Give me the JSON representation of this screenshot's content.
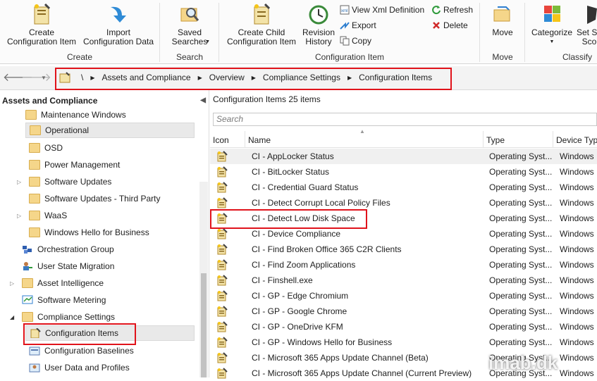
{
  "ribbon": {
    "create_ci": "Create\nConfiguration Item",
    "import_cd": "Import\nConfiguration Data",
    "group_create": "Create",
    "saved_searches": "Saved\nSearches",
    "group_search": "Search",
    "create_child": "Create Child\nConfiguration Item",
    "revision_history": "Revision\nHistory",
    "view_xml": "View Xml Definition",
    "export": "Export",
    "copy": "Copy",
    "refresh": "Refresh",
    "delete": "Delete",
    "group_ci": "Configuration Item",
    "move": "Move",
    "group_move": "Move",
    "categorize": "Categorize",
    "set_security": "Set Se\nSco",
    "group_classify": "Classify"
  },
  "address": {
    "root": "\\",
    "crumbs": [
      "Assets and Compliance",
      "Overview",
      "Compliance Settings",
      "Configuration Items"
    ]
  },
  "left": {
    "title": "Assets and Compliance",
    "items": [
      {
        "label": "Maintenance Windows"
      },
      {
        "label": "Operational"
      },
      {
        "label": "OSD"
      },
      {
        "label": "Power Management"
      },
      {
        "label": "Software Updates"
      },
      {
        "label": "Software Updates - Third Party"
      },
      {
        "label": "WaaS"
      },
      {
        "label": "Windows Hello for Business"
      },
      {
        "label": "Orchestration Group"
      },
      {
        "label": "User State Migration"
      },
      {
        "label": "Asset Intelligence"
      },
      {
        "label": "Software Metering"
      },
      {
        "label": "Compliance Settings"
      },
      {
        "label": "Configuration Items"
      },
      {
        "label": "Configuration Baselines"
      },
      {
        "label": "User Data and Profiles"
      }
    ]
  },
  "right": {
    "header": "Configuration Items 25 items",
    "search_placeholder": "Search",
    "columns": [
      "Icon",
      "Name",
      "Type",
      "Device Typ"
    ],
    "rows": [
      {
        "name": "CI - AppLocker Status",
        "type": "Operating Syst...",
        "device": "Windows"
      },
      {
        "name": "CI - BitLocker Status",
        "type": "Operating Syst...",
        "device": "Windows"
      },
      {
        "name": "CI - Credential Guard Status",
        "type": "Operating Syst...",
        "device": "Windows"
      },
      {
        "name": "CI - Detect Corrupt Local Policy Files",
        "type": "Operating Syst...",
        "device": "Windows"
      },
      {
        "name": "CI - Detect Low Disk Space",
        "type": "Operating Syst...",
        "device": "Windows"
      },
      {
        "name": "CI - Device Compliance",
        "type": "Operating Syst...",
        "device": "Windows"
      },
      {
        "name": "CI - Find Broken Office 365 C2R Clients",
        "type": "Operating Syst...",
        "device": "Windows"
      },
      {
        "name": "CI - Find Zoom Applications",
        "type": "Operating Syst...",
        "device": "Windows"
      },
      {
        "name": "CI - Finshell.exe",
        "type": "Operating Syst...",
        "device": "Windows"
      },
      {
        "name": "CI - GP - Edge Chromium",
        "type": "Operating Syst...",
        "device": "Windows"
      },
      {
        "name": "CI - GP - Google Chrome",
        "type": "Operating Syst...",
        "device": "Windows"
      },
      {
        "name": "CI - GP - OneDrive KFM",
        "type": "Operating Syst...",
        "device": "Windows"
      },
      {
        "name": "CI - GP - Windows Hello for Business",
        "type": "Operating Syst...",
        "device": "Windows"
      },
      {
        "name": "CI - Microsoft 365 Apps Update Channel (Beta)",
        "type": "Operating Syst...",
        "device": "Windows"
      },
      {
        "name": "CI - Microsoft 365 Apps Update Channel (Current Preview)",
        "type": "Operating Syst...",
        "device": "Windows"
      }
    ]
  },
  "watermark": "imab.dk",
  "colors": {
    "highlight": "#e0131b",
    "selected": "#e9e9e9"
  }
}
